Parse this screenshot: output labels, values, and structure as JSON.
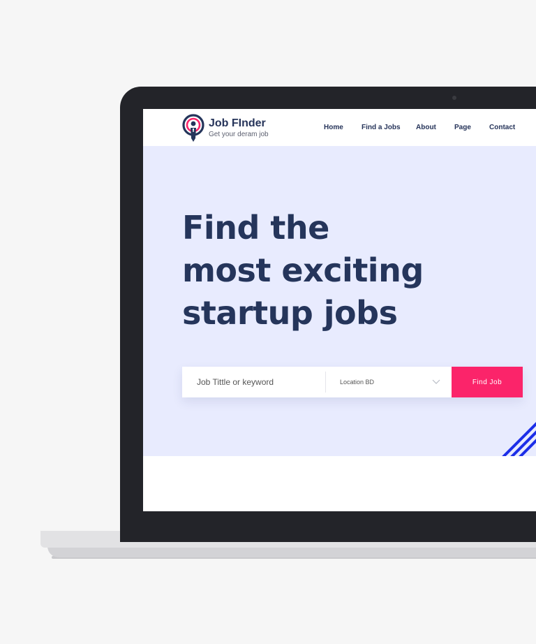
{
  "header": {
    "logo_title": "Job FInder",
    "logo_subtitle": "Get your deram job"
  },
  "nav": {
    "items": [
      "Home",
      "Find a Jobs",
      "About",
      "Page",
      "Contact"
    ]
  },
  "hero": {
    "title_lines": [
      "Find the",
      "most exciting",
      "startup jobs"
    ]
  },
  "search": {
    "keyword_placeholder": "Job Tittle or keyword",
    "location_value": "Location BD",
    "button_label": "Find Job"
  },
  "icons": {
    "logo": "target-person-icon",
    "location_dropdown": "chevron-down-icon",
    "decoration": "diagonal-stripes-icon"
  },
  "colors": {
    "background": "#f6f6f6",
    "bezel": "#232429",
    "hero_bg": "#e8ebfe",
    "heading": "#25355b",
    "accent": "#fb246a",
    "stripes": "#1c2ee8"
  }
}
